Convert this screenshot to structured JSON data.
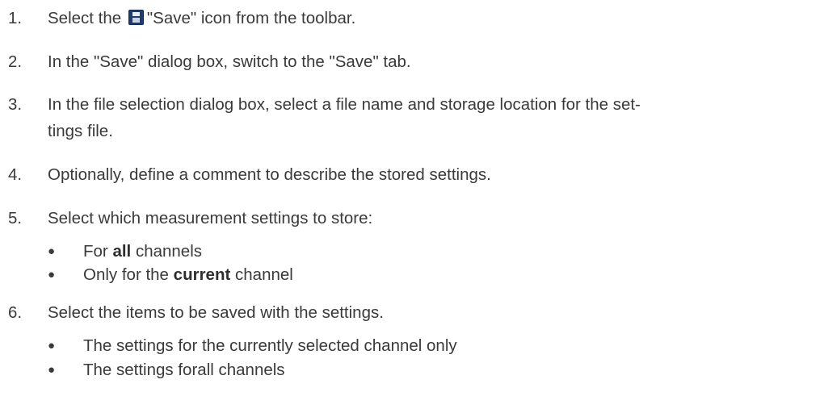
{
  "steps": [
    {
      "num": "1.",
      "pre": "Select the",
      "post": "\"Save\" icon from the toolbar."
    },
    {
      "num": "2.",
      "text": "In the \"Save\" dialog box, switch to the \"Save\" tab."
    },
    {
      "num": "3.",
      "line1": "In the file selection dialog box, select a file name and storage location for the set-",
      "line2": "tings file."
    },
    {
      "num": "4.",
      "text": "Optionally, define a comment to describe the stored settings."
    },
    {
      "num": "5.",
      "text": "Select which measurement settings to store:"
    },
    {
      "num": "6.",
      "text": "Select the items to be saved with the settings."
    }
  ],
  "step5_bullets": [
    {
      "pre": "For",
      "bold": "all",
      "post": "channels"
    },
    {
      "pre": "Only for the",
      "bold": "current",
      "post": "channel"
    }
  ],
  "step6_bullets": [
    "The settings for the currently selected channel only",
    "The settings forall channels"
  ],
  "bullet_glyph": "●",
  "icons": {
    "save": "save-icon"
  }
}
